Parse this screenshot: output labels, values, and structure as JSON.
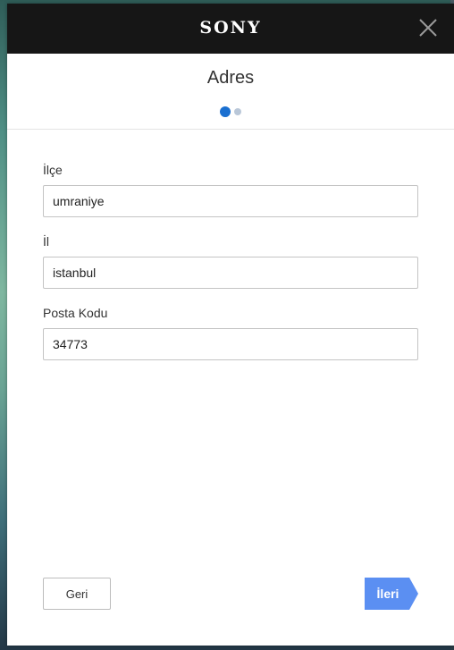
{
  "header": {
    "brand": "SONY",
    "background": "#161616"
  },
  "dialog": {
    "title": "Adres",
    "steps": {
      "total": 2,
      "current": 1
    },
    "accent": "#1a6fd0"
  },
  "form": {
    "district": {
      "label": "İlçe",
      "value": "umraniye"
    },
    "city": {
      "label": "İl",
      "value": "istanbul"
    },
    "postal_code": {
      "label": "Posta Kodu",
      "value": "34773"
    }
  },
  "actions": {
    "back_label": "Geri",
    "next_label": "İleri",
    "next_color": "#5b8ff2"
  },
  "icons": {
    "close": "close-icon"
  }
}
